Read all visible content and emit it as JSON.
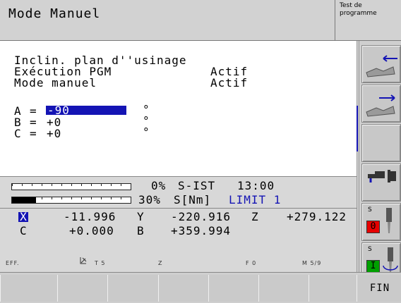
{
  "header": {
    "mode_title": "Mode Manuel",
    "secondary_mode": [
      "Test de",
      "programme"
    ]
  },
  "tilt": {
    "title": "Inclin. plan d''usinage",
    "pgm_label": "Exécution PGM",
    "pgm_value": "Actif",
    "manual_label": "Mode manuel",
    "manual_value": "Actif",
    "axes": [
      {
        "name": "A",
        "eq": "=",
        "value": "-90",
        "unit": "°"
      },
      {
        "name": "B",
        "eq": "=",
        "value": "+0",
        "unit": "°"
      },
      {
        "name": "C",
        "eq": "=",
        "value": "+0",
        "unit": "°"
      }
    ]
  },
  "status": {
    "row1": {
      "percent": "0%",
      "label": "S-IST",
      "time": "13:00",
      "bar_fill": 0.0
    },
    "row2": {
      "percent": "30%",
      "label": "S[Nm]",
      "limit": "LIMIT 1",
      "bar_fill": 0.2
    },
    "positions": [
      {
        "axis": "X",
        "value": "-11.996"
      },
      {
        "axis": "Y",
        "value": "-220.916"
      },
      {
        "axis": "Z",
        "value": "+279.122"
      },
      {
        "axis": "C",
        "value": "+0.000"
      },
      {
        "axis": "B",
        "value": "+359.994"
      }
    ],
    "bottom": {
      "eff": "EFF.",
      "tool": "T 5",
      "axis": "Z",
      "feed": "F 0",
      "m": "M 5/9"
    }
  },
  "softkeys": {
    "fin": "FIN",
    "spindle_label": "S",
    "spindle_off": "0",
    "spindle_on": "I"
  },
  "colors": {
    "accent": "#1414b4",
    "red": "#e60000",
    "green": "#00a000"
  }
}
